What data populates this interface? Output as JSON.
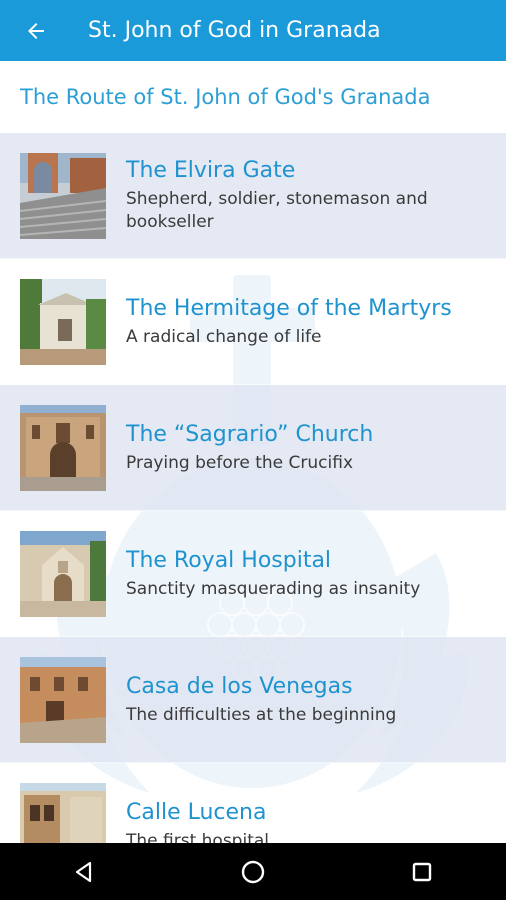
{
  "app_bar": {
    "title": "St. John of God in Granada",
    "back_icon": "arrow-left-icon",
    "color": "#1a9ad8"
  },
  "subheader": {
    "title": "The Route of St. John of God's Granada"
  },
  "route_items": [
    {
      "title": "The Elvira Gate",
      "subtitle": "Shepherd, soldier, stonemason and bookseller"
    },
    {
      "title": "The Hermitage of the Martyrs",
      "subtitle": "A radical change of life"
    },
    {
      "title": "The “Sagrario” Church",
      "subtitle": "Praying before the Crucifix"
    },
    {
      "title": "The Royal Hospital",
      "subtitle": "Sanctity masquerading as insanity"
    },
    {
      "title": "Casa de los Venegas",
      "subtitle": "The difficulties at the beginning"
    },
    {
      "title": "Calle Lucena",
      "subtitle": "The first hospital"
    }
  ],
  "nav_bar": {
    "buttons": [
      "back-triangle-icon",
      "home-circle-icon",
      "recents-square-icon"
    ]
  },
  "colors": {
    "accent": "#1a9ad8",
    "title_text": "#1f93cf",
    "row_shade": "#e2e7f2"
  }
}
